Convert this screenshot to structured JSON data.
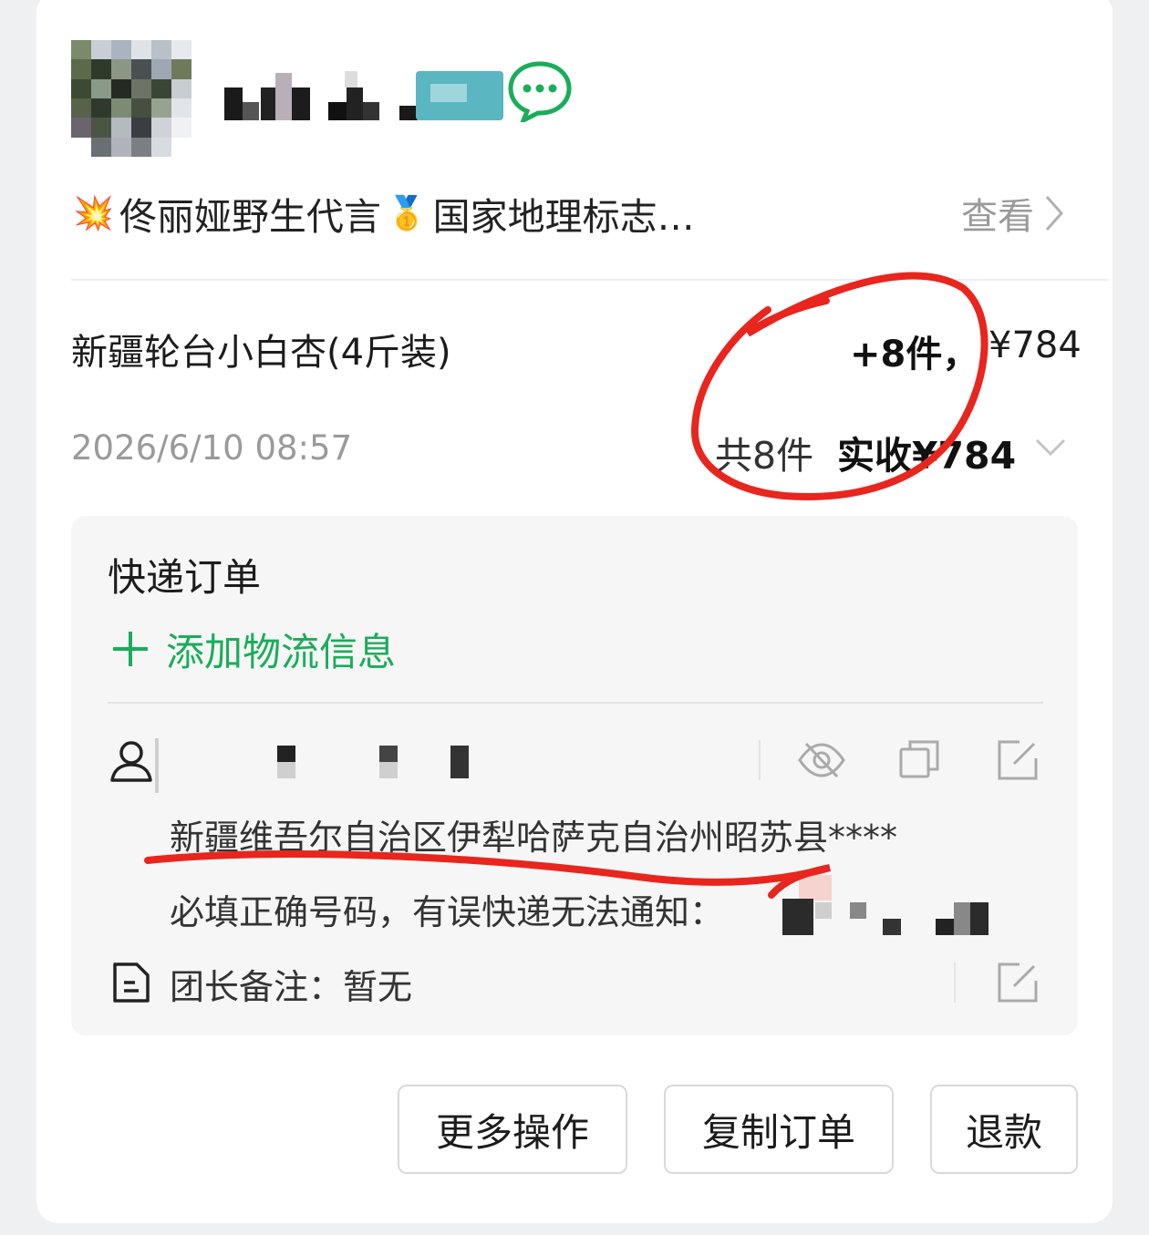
{
  "header": {
    "slogan_text": "佟丽娅野生代言",
    "slogan_text2": "国家地理标志…",
    "emoji_1": "💥",
    "emoji_2": "🥇",
    "view_label": "查看"
  },
  "order": {
    "product_name": "新疆轮台小白杏(4斤装)",
    "quantity_added": "+8件，",
    "price": "¥784",
    "order_time": "2026/6/10 08:57",
    "total_count": "共8件",
    "total_paid": "实收¥784"
  },
  "delivery": {
    "title": "快递订单",
    "add_logistics_label": "添加物流信息",
    "address": "新疆维吾尔自治区伊犁哈萨克自治州昭苏县****",
    "phone_hint": "必填正确号码，有误快递无法通知：",
    "note_label": "团长备注：",
    "note_value": "暂无"
  },
  "actions": {
    "more_label": "更多操作",
    "copy_label": "复制订单",
    "refund_label": "退款"
  },
  "colors": {
    "accent_green": "#1aad5a",
    "annotation_red": "#e8261e",
    "muted_text": "#9a9a9a"
  },
  "icons": [
    "chat-icon",
    "chevron-right-icon",
    "chevron-down-icon",
    "plus-icon",
    "person-icon",
    "eye-hidden-icon",
    "copy-icon",
    "edit-icon",
    "note-icon"
  ]
}
